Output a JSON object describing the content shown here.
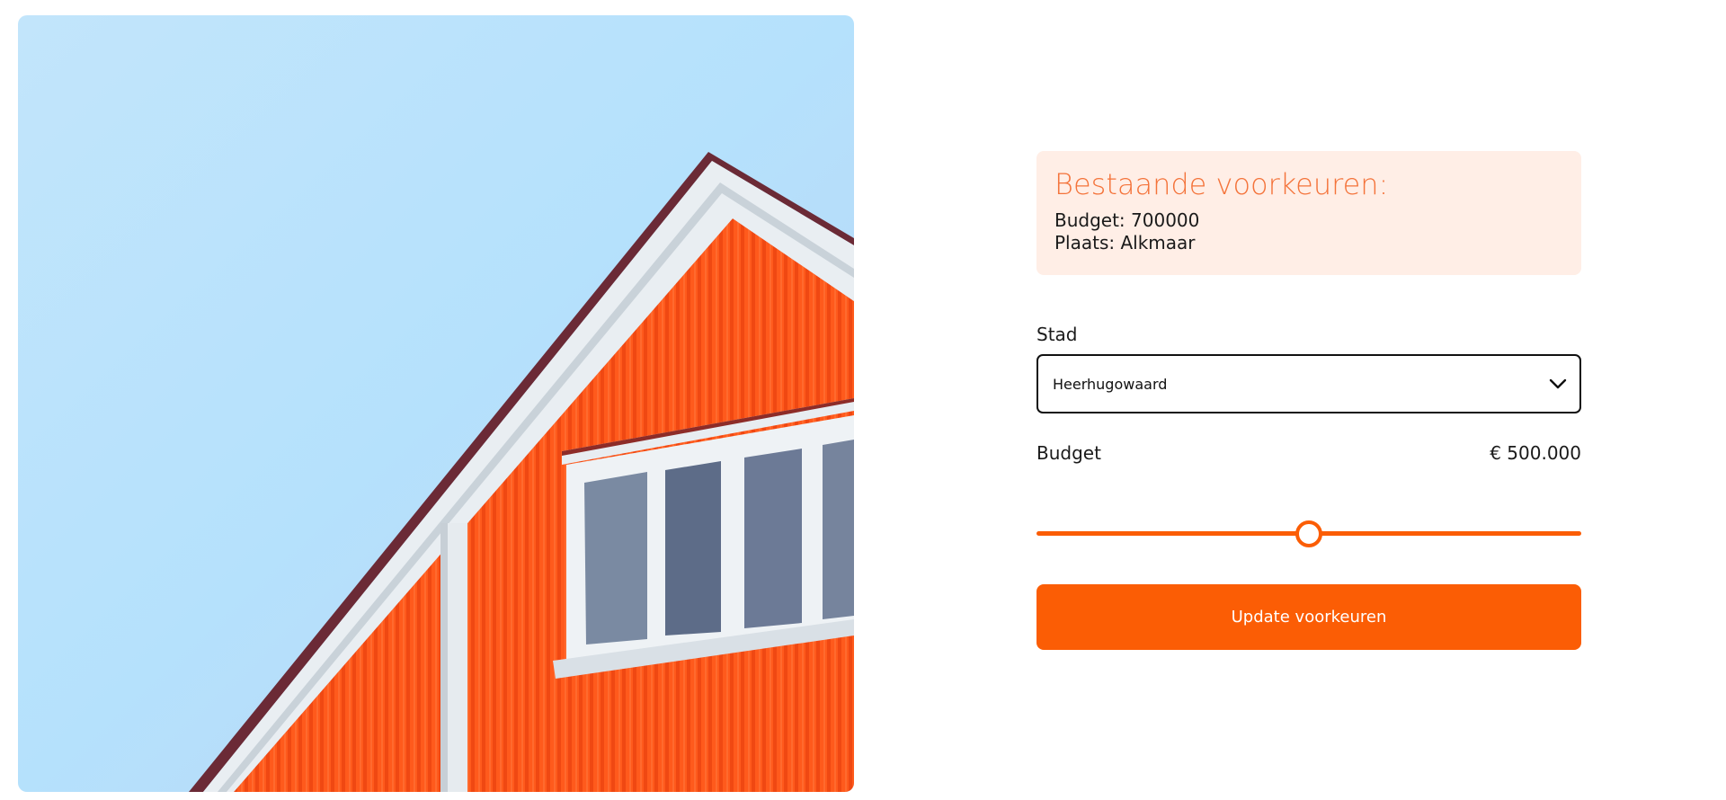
{
  "hero": {
    "image_alt": "Orange house with white-framed windows against blue sky"
  },
  "existing_preferences": {
    "title": "Bestaande voorkeuren:",
    "budget_line": "Budget: 700000",
    "place_line": "Plaats: Alkmaar"
  },
  "form": {
    "city_label": "Stad",
    "city_value": "Heerhugowaard",
    "budget_label": "Budget",
    "budget_display": "€ 500.000",
    "budget_slider_fraction": 0.5,
    "submit_label": "Update voorkeuren"
  },
  "colors": {
    "accent": "#fb5d05",
    "prefs_bg": "#ffeee6",
    "prefs_title": "#f4733a"
  },
  "icons": {
    "select_chevron": "chevron-down-icon"
  }
}
